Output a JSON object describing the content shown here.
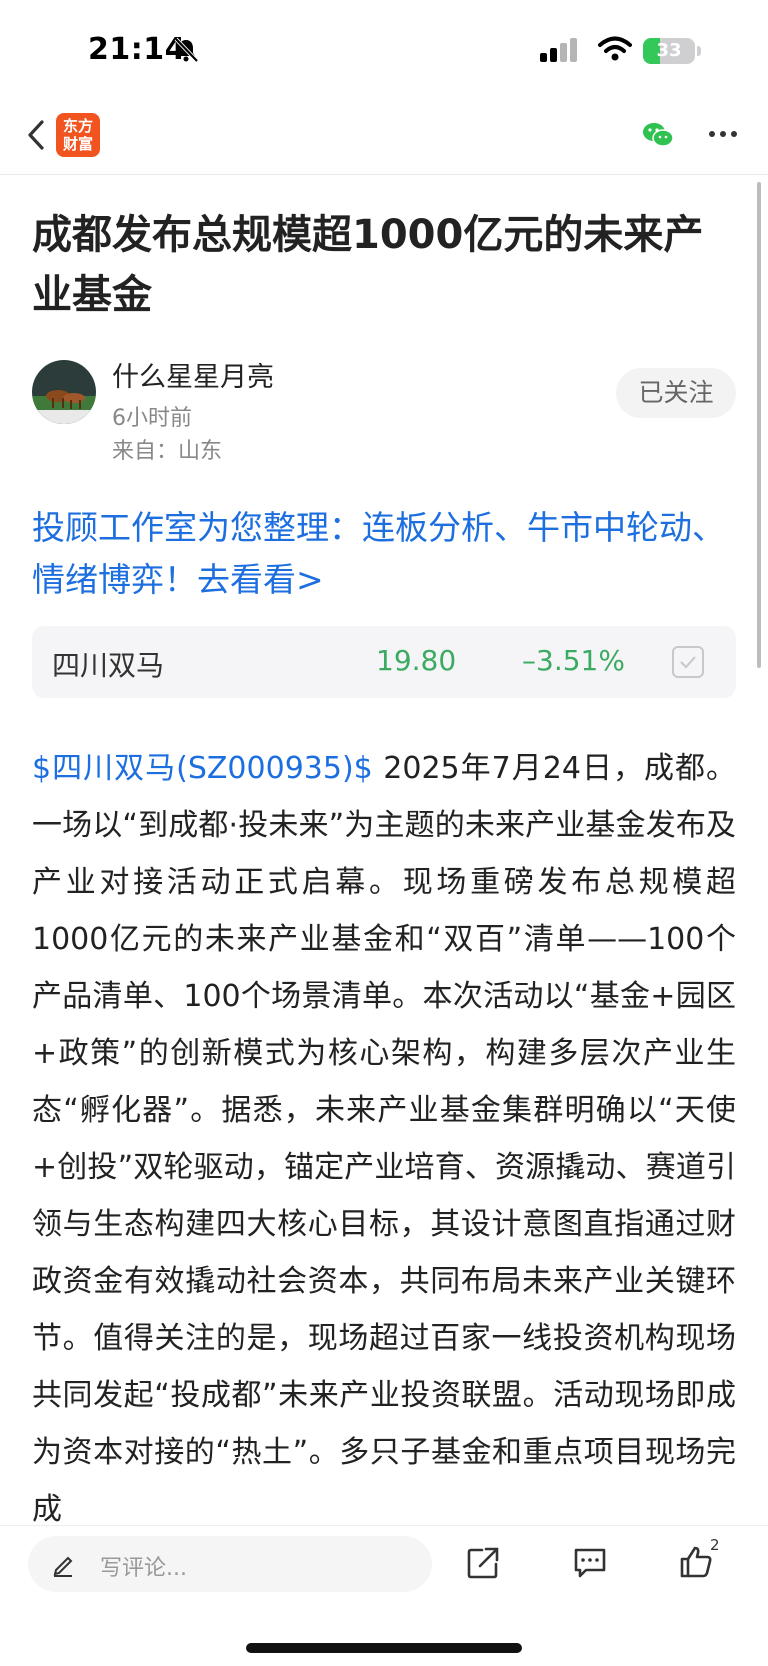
{
  "status_bar": {
    "time": "21:14",
    "battery": "33",
    "battery_level": 0.33
  },
  "nav": {
    "logo_text": "东方财富",
    "icons": [
      "back-icon",
      "wechat-icon",
      "more-icon"
    ]
  },
  "article": {
    "title": "成都发布总规模超1000亿元的未来产业基金",
    "author": "什么星星月亮",
    "time_ago": "6小时前",
    "from": "来自：山东",
    "follow_label": "已关注",
    "promo": "投顾工作室为您整理：连板分析、牛市中轮动、情绪博弈！去看看>",
    "stock": {
      "name": "四川双马",
      "price": "19.80",
      "change": "–3.51%",
      "color": "#3cab62"
    },
    "body_link": "$四川双马(SZ000935)$",
    "body_text": "   2025年7月24日，成都。一场以“到成都·投未来”为主题的未来产业基金发布及产业对接活动正式启幕。现场重磅发布总规模超1000亿元的未来产业基金和“双百”清单——100个产品清单、100个场景清单。本次活动以“基金+园区+政策”的创新模式为核心架构，构建多层次产业生态“孵化器”。据悉，未来产业基金集群明确以“天使+创投”双轮驱动，锚定产业培育、资源撬动、赛道引领与生态构建四大核心目标，其设计意图直指通过财政资金有效撬动社会资本，共同布局未来产业关键环节。值得关注的是，现场超过百家一线投资机构现场共同发起“投成都”未来产业投资联盟。活动现场即成为资本对接的“热土”。多只子基金和重点项目现场完成"
  },
  "bottom_bar": {
    "comment_placeholder": "写评论...",
    "like_count": "2"
  },
  "colors": {
    "link_blue": "#1d6fe0",
    "brand_orange": "#f2541f",
    "stock_green": "#3cab62"
  }
}
